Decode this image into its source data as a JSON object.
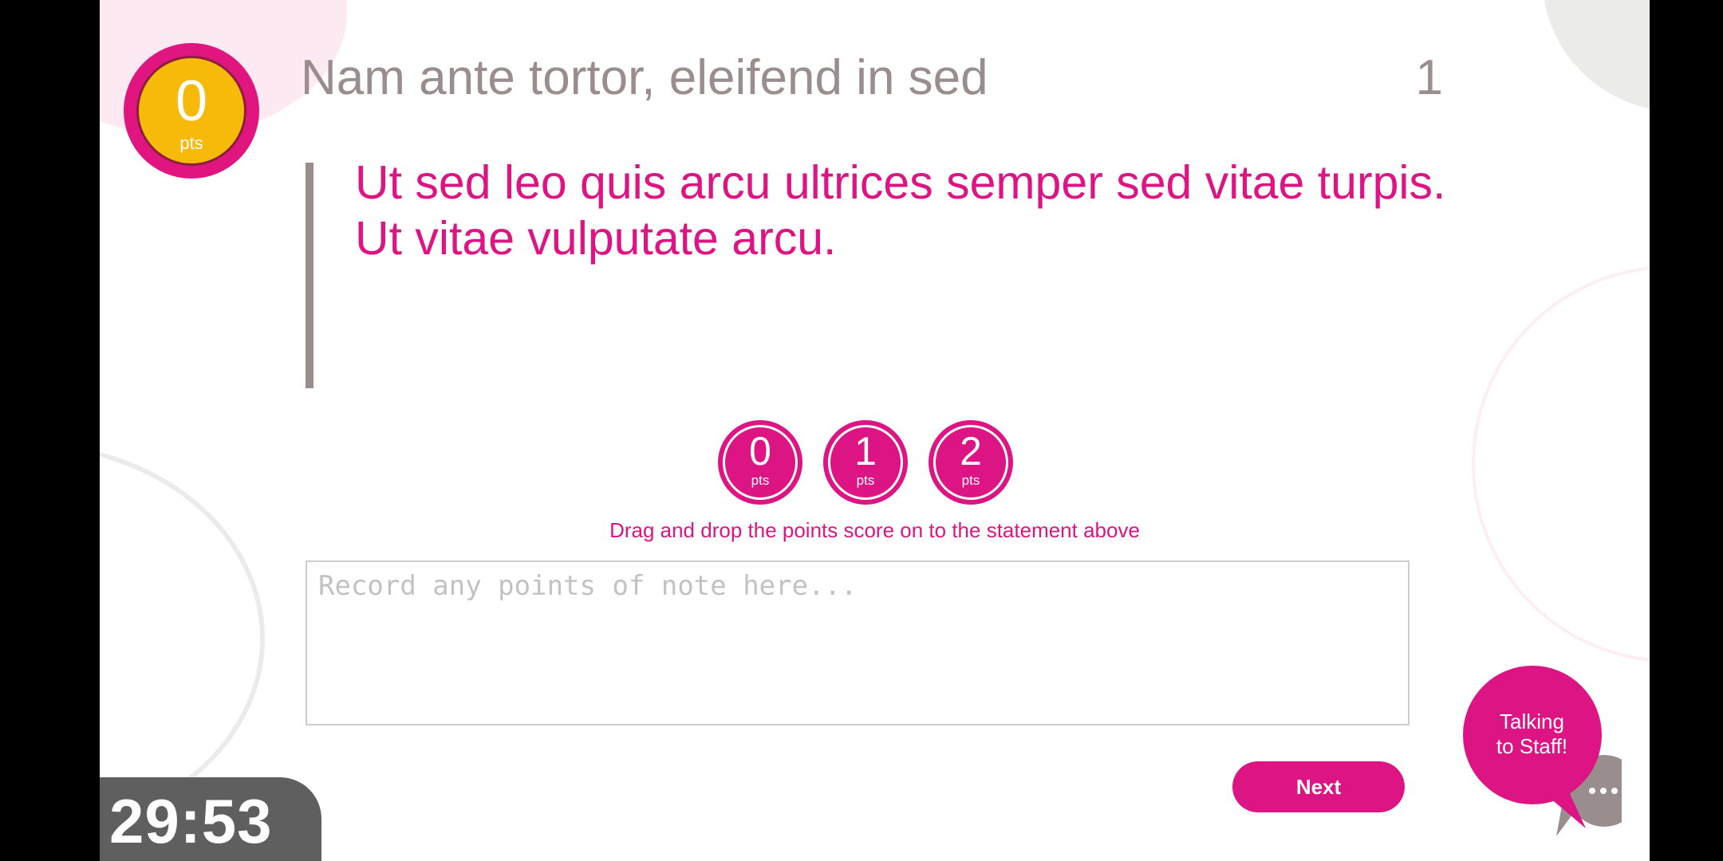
{
  "score": {
    "value": "0",
    "unit": "pts"
  },
  "header": {
    "title": "Nam ante tortor, eleifend in sed",
    "question_number": "1"
  },
  "statement": "Ut sed leo quis arcu ultrices semper sed vitae turpis. Ut vitae vulputate arcu.",
  "tokens": [
    {
      "value": "0",
      "unit": "pts"
    },
    {
      "value": "1",
      "unit": "pts"
    },
    {
      "value": "2",
      "unit": "pts"
    }
  ],
  "instruction": "Drag and drop the points score on to the statement above",
  "notes": {
    "value": "",
    "placeholder": "Record any points of note here..."
  },
  "next_label": "Next",
  "staff_chat": {
    "line1": "Talking",
    "line2": "to Staff!",
    "icon": "ellipsis-icon"
  },
  "timer": "29:53",
  "colors": {
    "accent": "#dd1483",
    "gold": "#f7b90a",
    "muted": "#9a8d8d",
    "timer_bg": "#5f5f5f"
  }
}
